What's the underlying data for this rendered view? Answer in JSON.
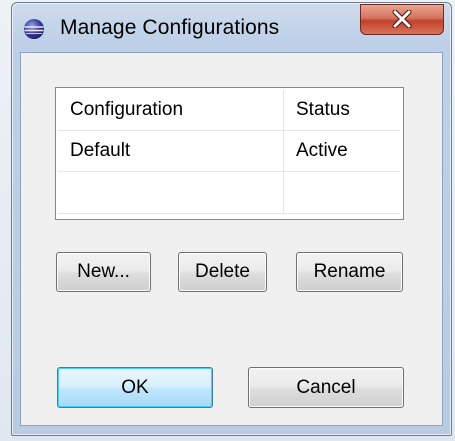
{
  "window": {
    "title": "Manage Configurations"
  },
  "table": {
    "columns": [
      "Configuration",
      "Status"
    ],
    "rows": [
      [
        "Default",
        "Active"
      ],
      [
        "",
        ""
      ]
    ]
  },
  "actions": {
    "new_label": "New...",
    "delete_label": "Delete",
    "rename_label": "Rename"
  },
  "dialog_buttons": {
    "ok_label": "OK",
    "cancel_label": "Cancel"
  },
  "icons": {
    "app": "app-globe-icon",
    "close": "close-icon"
  },
  "colors": {
    "close_button": "#c2412a",
    "ok_button_border": "#3c7fb1"
  }
}
